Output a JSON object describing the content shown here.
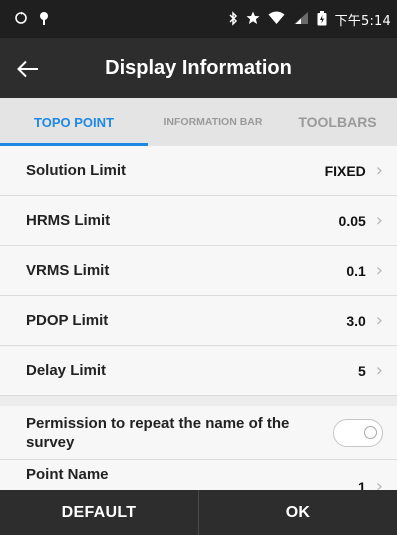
{
  "status_bar": {
    "left_icons": [
      "sync-icon",
      "location-pin-icon"
    ],
    "right_icons": [
      "bluetooth-icon",
      "star-icon",
      "wifi-icon",
      "signal-icon",
      "battery-icon"
    ],
    "time": "下午5:14"
  },
  "app_bar": {
    "title": "Display Information",
    "back_icon": "arrow-left-icon"
  },
  "tabs": [
    {
      "label": "TOPO POINT",
      "active": true
    },
    {
      "label": "INFORMATION BAR",
      "active": false
    },
    {
      "label": "TOOLBARS",
      "active": false
    }
  ],
  "settings": [
    {
      "label": "Solution Limit",
      "value": "FIXED"
    },
    {
      "label": "HRMS Limit",
      "value": "0.05"
    },
    {
      "label": "VRMS Limit",
      "value": "0.1"
    },
    {
      "label": "PDOP Limit",
      "value": "3.0"
    },
    {
      "label": "Delay Limit",
      "value": "5"
    }
  ],
  "toggle_setting": {
    "label": "Permission to repeat the name of the survey",
    "enabled": false
  },
  "partial_setting": {
    "label": "Point Name",
    "value": "1"
  },
  "bottom_bar": {
    "default_label": "DEFAULT",
    "ok_label": "OK"
  },
  "colors": {
    "accent": "#1e88e5",
    "app_bar": "#2d2d2d",
    "status_bar": "#1f1f1f"
  }
}
